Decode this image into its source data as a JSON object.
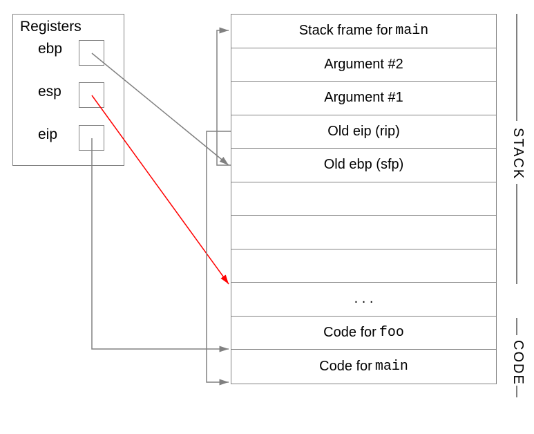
{
  "registers": {
    "title": "Registers",
    "items": [
      {
        "name": "ebp"
      },
      {
        "name": "esp"
      },
      {
        "name": "eip"
      }
    ]
  },
  "memory": {
    "rows": [
      {
        "prefix": "Stack frame for ",
        "code": "main"
      },
      {
        "text": "Argument #2"
      },
      {
        "text": "Argument #1"
      },
      {
        "text": "Old eip (rip)"
      },
      {
        "text": "Old ebp (sfp)"
      },
      {
        "text": ""
      },
      {
        "text": ""
      },
      {
        "text": ""
      },
      {
        "text": ". . ."
      },
      {
        "prefix": "Code for ",
        "code": "foo"
      },
      {
        "prefix": "Code for ",
        "code": "main"
      }
    ]
  },
  "sections": {
    "stack": "STACK",
    "code": "CODE"
  },
  "arrows": {
    "ebp_to_old_ebp": {
      "color": "#808080"
    },
    "esp_to_blank": {
      "color": "#ff0000"
    },
    "eip_to_code_foo": {
      "color": "#808080"
    },
    "old_eip_to_code_main": {
      "color": "#808080"
    },
    "old_ebp_to_main_frame": {
      "color": "#808080"
    }
  }
}
